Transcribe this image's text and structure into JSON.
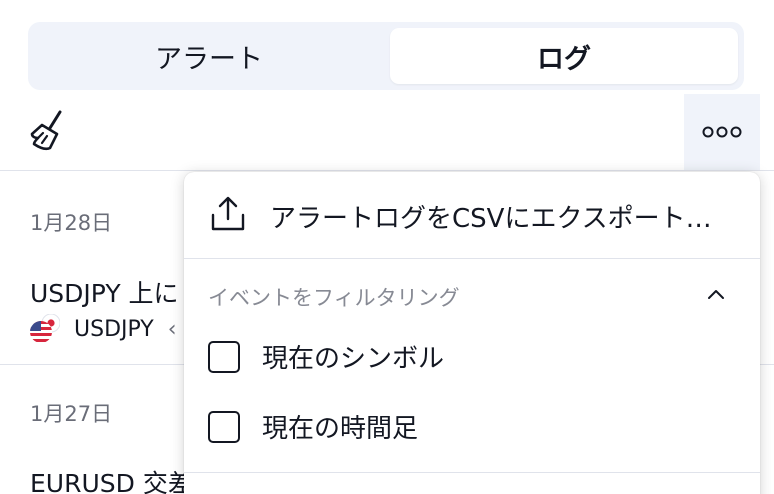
{
  "tabs": {
    "alerts_label": "アラート",
    "log_label": "ログ",
    "active": "log"
  },
  "toolbar": {
    "clear_icon": "broom-icon",
    "more_icon": "more-horizontal-icon"
  },
  "log": {
    "entries": [
      {
        "date": "1月28日",
        "title": "USDJPY 上に",
        "symbol": "USDJPY",
        "suffix": "‹"
      },
      {
        "date": "1月27日",
        "title": "EURUSD 交差",
        "symbol": "",
        "suffix": ""
      }
    ]
  },
  "menu": {
    "export_label": "アラートログをCSVにエクスポート…",
    "export_icon": "upload-icon",
    "filter_header": "イベントをフィルタリング",
    "filter_collapse_icon": "chevron-up-icon",
    "filters": [
      {
        "label": "現在のシンボル",
        "checked": false
      },
      {
        "label": "現在の時間足",
        "checked": false
      }
    ]
  },
  "colors": {
    "text_primary": "#131722",
    "text_secondary": "#6a6d78",
    "tab_track": "#f0f3fa",
    "divider": "#e0e3eb"
  }
}
